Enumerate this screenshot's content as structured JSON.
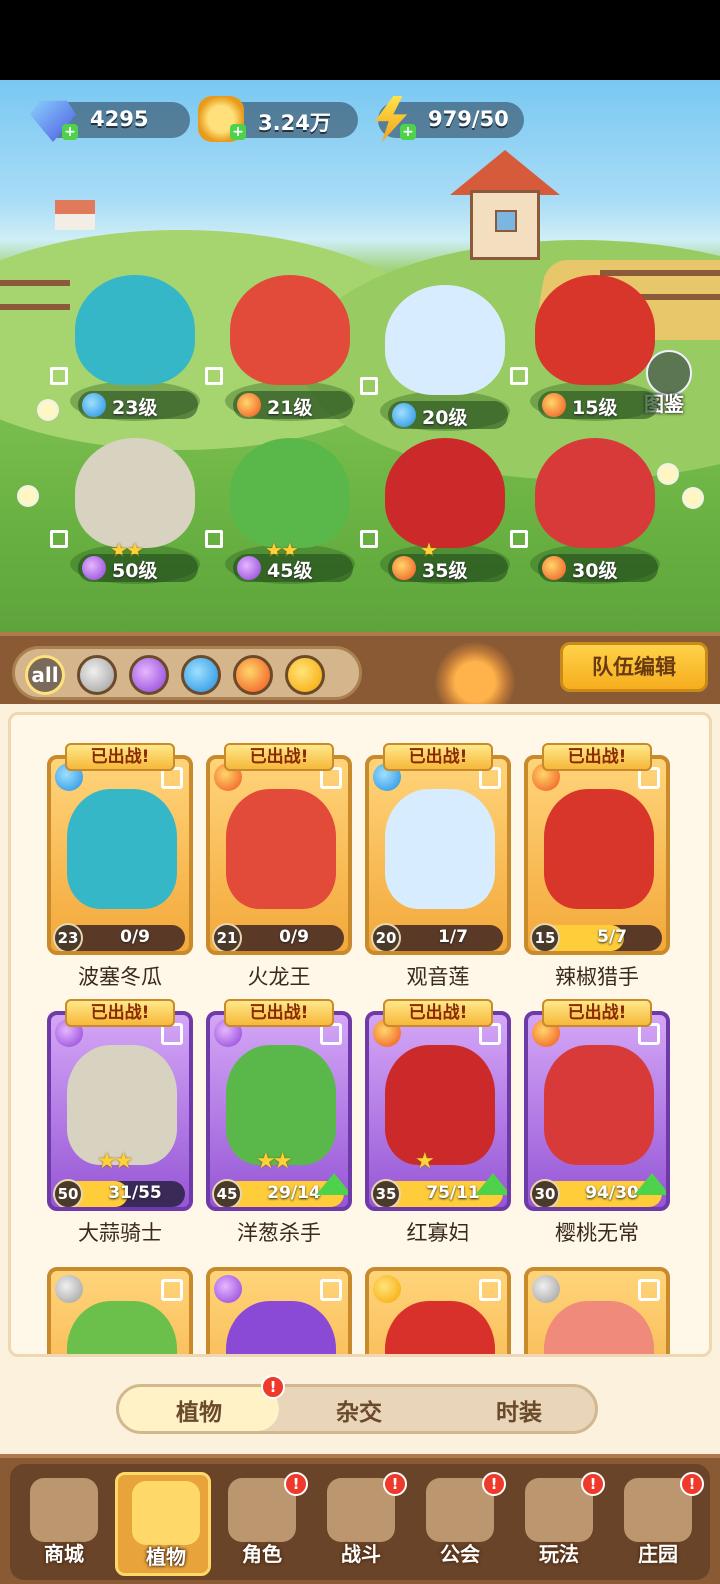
{
  "resources": {
    "diamonds": "4295",
    "gold": "3.24万",
    "energy": "979/50"
  },
  "codex_label": "图鉴",
  "team_plants": [
    {
      "level": "23级",
      "element": "water",
      "grid": "4"
    },
    {
      "level": "21级",
      "element": "fire",
      "grid": "4"
    },
    {
      "level": "20级",
      "element": "water",
      "grid": "2"
    },
    {
      "level": "15级",
      "element": "fire",
      "grid": "2"
    },
    {
      "level": "50级",
      "element": "magic",
      "grid": "1",
      "stars": "★★"
    },
    {
      "level": "45级",
      "element": "magic",
      "grid": "4",
      "stars": "★★"
    },
    {
      "level": "35级",
      "element": "fire",
      "grid": "3",
      "stars": "★"
    },
    {
      "level": "30级",
      "element": "fire",
      "grid": "2"
    }
  ],
  "filters": {
    "all": "all",
    "icons": [
      "sword-icon",
      "potion-icon",
      "water-drop-icon",
      "fire-icon",
      "lightning-icon"
    ]
  },
  "edit_team_label": "队伍编辑",
  "deployed_label": "已出战!",
  "cards": [
    {
      "name": "波塞冬瓜",
      "level": "23",
      "progress": "0/9",
      "progress_value": 0.0,
      "element": "water",
      "rarity": "gold"
    },
    {
      "name": "火龙王",
      "level": "21",
      "progress": "0/9",
      "progress_value": 0.0,
      "element": "fire",
      "rarity": "gold"
    },
    {
      "name": "观音莲",
      "level": "20",
      "progress": "1/7",
      "progress_value": 0.14,
      "element": "water",
      "rarity": "gold"
    },
    {
      "name": "辣椒猎手",
      "level": "15",
      "progress": "5/7",
      "progress_value": 0.71,
      "element": "fire",
      "rarity": "gold"
    },
    {
      "name": "大蒜骑士",
      "level": "50",
      "progress": "31/55",
      "progress_value": 0.56,
      "element": "magic",
      "rarity": "purple",
      "stars": "★★"
    },
    {
      "name": "洋葱杀手",
      "level": "45",
      "progress": "29/14",
      "progress_value": 1.0,
      "element": "magic",
      "rarity": "purple",
      "stars": "★★",
      "upgrade": true
    },
    {
      "name": "红寡妇",
      "level": "35",
      "progress": "75/11",
      "progress_value": 1.0,
      "element": "fire",
      "rarity": "purple",
      "stars": "★",
      "upgrade": true
    },
    {
      "name": "樱桃无常",
      "level": "30",
      "progress": "94/30",
      "progress_value": 1.0,
      "element": "fire",
      "rarity": "purple",
      "upgrade": true
    }
  ],
  "partial_cards": [
    {
      "element": "sword"
    },
    {
      "element": "magic"
    },
    {
      "element": "thunder"
    },
    {
      "element": "sword"
    }
  ],
  "tabs": {
    "plants": "植物",
    "hybrid": "杂交",
    "costume": "时装",
    "notice": "!"
  },
  "nav": [
    {
      "label": "商城",
      "badge": ""
    },
    {
      "label": "植物",
      "badge": ""
    },
    {
      "label": "角色",
      "badge": "!"
    },
    {
      "label": "战斗",
      "badge": "!"
    },
    {
      "label": "公会",
      "badge": "!"
    },
    {
      "label": "玩法",
      "badge": "!"
    },
    {
      "label": "庄园",
      "badge": "!"
    }
  ],
  "colors": {
    "water": "#1f8ee0",
    "fire": "#f0501e",
    "magic": "#8c3fd6",
    "gold_card": "#f3a83a",
    "purple_card": "#9656d6",
    "badge": "#ee3a2a"
  }
}
